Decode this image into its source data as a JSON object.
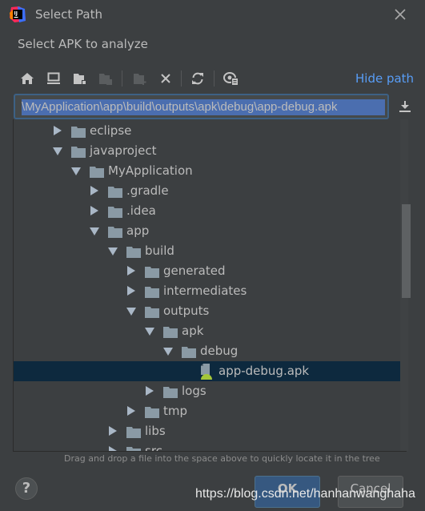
{
  "window": {
    "title": "Select Path",
    "subtitle": "Select APK to analyze",
    "app_icon": "intellij-idea-icon",
    "close_icon": "close-icon"
  },
  "toolbar": {
    "buttons": [
      {
        "name": "home-directory",
        "icon": "home-icon",
        "enabled": true
      },
      {
        "name": "desktop-directory",
        "icon": "desktop-icon",
        "enabled": true
      },
      {
        "name": "project-directory",
        "icon": "folder-project-icon",
        "enabled": true
      },
      {
        "name": "module-directory",
        "icon": "folder-module-icon",
        "enabled": false
      },
      {
        "name": "new-folder",
        "icon": "new-folder-icon",
        "enabled": false
      },
      {
        "name": "delete",
        "icon": "delete-icon",
        "enabled": true
      },
      {
        "name": "refresh",
        "icon": "refresh-icon",
        "enabled": true
      },
      {
        "name": "show-hidden",
        "icon": "show-hidden-icon",
        "enabled": true
      }
    ],
    "hide_path_label": "Hide path"
  },
  "path": {
    "value": "\\MyApplication\\app\\build\\outputs\\apk\\debug\\app-debug.apk",
    "download_icon": "download-icon"
  },
  "tree": {
    "items": [
      {
        "label": "eclipse",
        "depth": 0,
        "state": "collapsed",
        "type": "folder"
      },
      {
        "label": "javaproject",
        "depth": 0,
        "state": "expanded",
        "type": "folder"
      },
      {
        "label": "MyApplication",
        "depth": 1,
        "state": "expanded",
        "type": "folder"
      },
      {
        "label": ".gradle",
        "depth": 2,
        "state": "collapsed",
        "type": "folder"
      },
      {
        "label": ".idea",
        "depth": 2,
        "state": "collapsed",
        "type": "folder"
      },
      {
        "label": "app",
        "depth": 2,
        "state": "expanded",
        "type": "folder"
      },
      {
        "label": "build",
        "depth": 3,
        "state": "expanded",
        "type": "folder"
      },
      {
        "label": "generated",
        "depth": 4,
        "state": "collapsed",
        "type": "folder"
      },
      {
        "label": "intermediates",
        "depth": 4,
        "state": "collapsed",
        "type": "folder"
      },
      {
        "label": "outputs",
        "depth": 4,
        "state": "expanded",
        "type": "folder"
      },
      {
        "label": "apk",
        "depth": 5,
        "state": "expanded",
        "type": "folder"
      },
      {
        "label": "debug",
        "depth": 6,
        "state": "expanded",
        "type": "folder"
      },
      {
        "label": "app-debug.apk",
        "depth": 7,
        "state": "leaf",
        "type": "apk",
        "selected": true
      },
      {
        "label": "logs",
        "depth": 5,
        "state": "collapsed",
        "type": "folder"
      },
      {
        "label": "tmp",
        "depth": 4,
        "state": "collapsed",
        "type": "folder"
      },
      {
        "label": "libs",
        "depth": 3,
        "state": "collapsed",
        "type": "folder"
      },
      {
        "label": "src",
        "depth": 3,
        "state": "collapsed",
        "type": "folder"
      }
    ]
  },
  "hint": "Drag and drop a file into the space above to quickly locate it in the tree",
  "footer": {
    "help_label": "?",
    "ok_label": "OK",
    "cancel_label": "Cancel"
  },
  "watermark": "https://blog.csdn.net/hanhanwanghaha",
  "colors": {
    "background": "#3c3f41",
    "accent_link": "#589df6",
    "selection": "#0d293e",
    "ok_button": "#365880",
    "android_green": "#a4c639"
  }
}
